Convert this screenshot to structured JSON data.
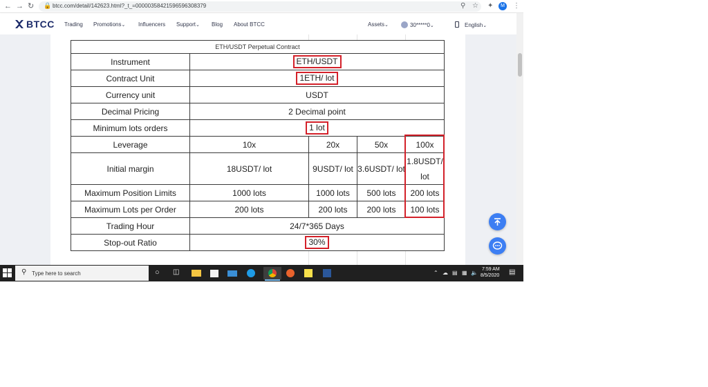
{
  "browser": {
    "url": "btcc.com/detail/142623.html?_t_=000003584215965963083​79",
    "profile_initial": "M"
  },
  "header": {
    "logo_text": "BTCC",
    "nav": [
      "Trading",
      "Promotions",
      "Influencers",
      "Support",
      "Blog",
      "About BTCC"
    ],
    "assets_label": "Assets",
    "account_label": "30*****0",
    "language_label": "English"
  },
  "table": {
    "title": "ETH/USDT Perpetual Contract",
    "rows": {
      "instrument": {
        "label": "Instrument",
        "value": "ETH/USDT"
      },
      "contract_unit": {
        "label": "Contract Unit",
        "value": "1ETH/ lot"
      },
      "currency_unit": {
        "label": "Currency unit",
        "value": "USDT"
      },
      "decimal_pricing": {
        "label": "Decimal Pricing",
        "value": "2 Decimal point"
      },
      "min_lots": {
        "label": "Minimum lots orders",
        "value": "1 lot"
      },
      "leverage": {
        "label": "Leverage",
        "values": [
          "10x",
          "20x",
          "50x",
          "100x"
        ]
      },
      "initial_margin": {
        "label": "Initial margin",
        "values": [
          "18USDT/ lot",
          "9USDT/ lot",
          "3.6USDT/ lot",
          "1.8USDT/ lot"
        ]
      },
      "max_position": {
        "label": "Maximum Position Limits",
        "values": [
          "1000 lots",
          "1000 lots",
          "500 lots",
          "200 lots"
        ]
      },
      "max_lots_order": {
        "label": "Maximum Lots per Order",
        "values": [
          "200 lots",
          "200 lots",
          "200 lots",
          "100 lots"
        ]
      },
      "trading_hour": {
        "label": "Trading Hour",
        "value": "24/7*365 Days"
      },
      "stop_out": {
        "label": "Stop-out Ratio",
        "value": "30%"
      }
    }
  },
  "taskbar": {
    "search_placeholder": "Type here to search",
    "clock_time": "7:59 AM",
    "clock_date": "8/5/2020"
  },
  "colors": {
    "highlight": "#d32029",
    "brand": "#1c2b6a",
    "float_button": "#3c7ef3"
  }
}
